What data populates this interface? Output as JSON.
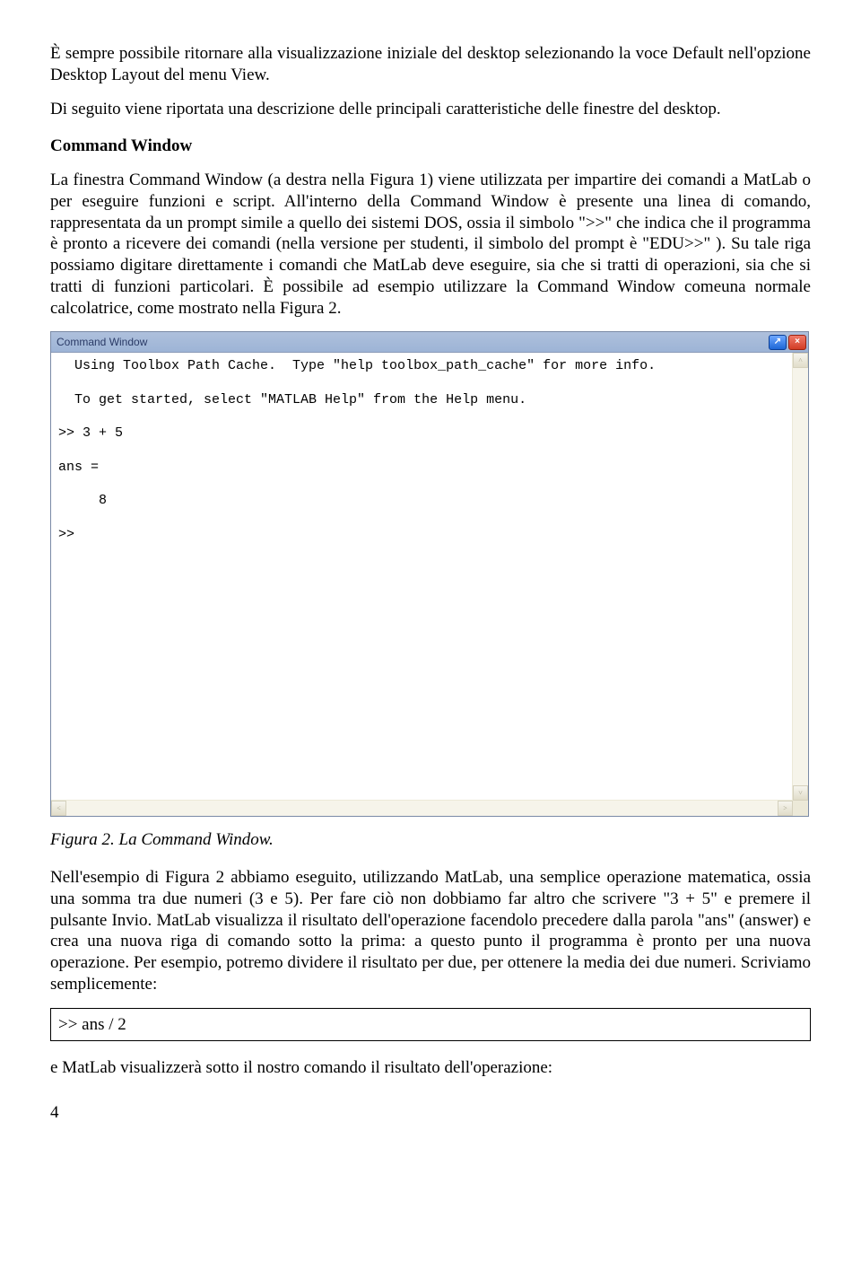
{
  "para1": "È sempre possibile ritornare alla visualizzazione iniziale del desktop selezionando la voce Default nell'opzione Desktop Layout del menu View.",
  "para2": "Di seguito viene riportata una descrizione delle principali caratteristiche delle finestre del desktop.",
  "heading1": "Command Window",
  "para3": "La finestra Command Window (a destra nella Figura 1) viene utilizzata per impartire dei comandi a MatLab o per eseguire funzioni e script. All'interno della Command Window è presente una linea di comando, rappresentata da un prompt simile a quello dei sistemi DOS, ossia il simbolo \">>\" che indica che il programma è pronto a ricevere dei comandi (nella versione per studenti, il simbolo del prompt è \"EDU>>\" ). Su tale riga possiamo digitare direttamente i comandi che MatLab deve eseguire, sia che si tratti di operazioni, sia che si tratti di funzioni particolari. È possibile ad esempio utilizzare la Command Window comeuna normale calcolatrice, come mostrato nella Figura 2.",
  "cmdwin": {
    "title": "Command Window",
    "undock_icon": "↗",
    "close_icon": "×",
    "lines": [
      "  Using Toolbox Path Cache.  Type \"help toolbox_path_cache\" for more info.",
      " ",
      "  To get started, select \"MATLAB Help\" from the Help menu.",
      " ",
      ">> 3 + 5",
      "",
      "ans =",
      "",
      "     8",
      "",
      ">> "
    ],
    "scroll_up": "˄",
    "scroll_down": "˅",
    "scroll_left": "˂",
    "scroll_right": "˃"
  },
  "caption": "Figura 2. La Command Window.",
  "para4": "Nell'esempio di Figura 2 abbiamo eseguito, utilizzando MatLab, una semplice operazione matematica, ossia una somma tra due numeri (3 e 5). Per fare ciò non dobbiamo far altro che scrivere \"3 + 5\" e premere il pulsante Invio. MatLab visualizza il risultato dell'operazione facendolo precedere dalla parola \"ans\" (answer) e crea una nuova riga di comando sotto la prima: a questo punto il programma è pronto per una nuova operazione. Per esempio, potremo dividere il risultato per due, per ottenere la media dei due numeri. Scriviamo semplicemente:",
  "codebox1": ">> ans / 2",
  "para5": "e MatLab visualizzerà sotto il nostro comando il risultato dell'operazione:",
  "page_number": "4"
}
